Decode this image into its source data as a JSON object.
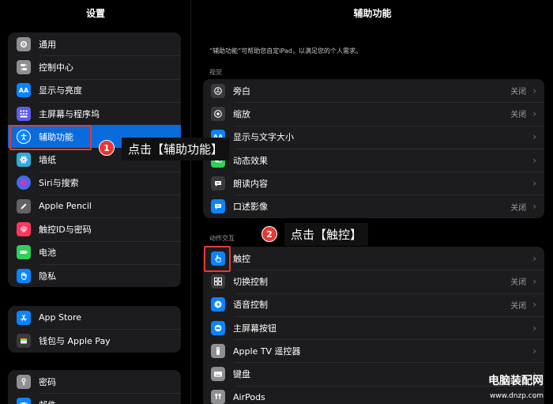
{
  "sidebar": {
    "title": "设置",
    "group1": [
      {
        "label": "通用",
        "icon": "gear-icon",
        "color": "#8e8e93"
      },
      {
        "label": "控制中心",
        "icon": "toggles-icon",
        "color": "#8e8e93"
      },
      {
        "label": "显示与亮度",
        "icon": "text-size-icon",
        "color": "#0a84ff"
      },
      {
        "label": "主屏幕与程序坞",
        "icon": "grid-icon",
        "color": "#5e5ce6"
      },
      {
        "label": "辅助功能",
        "icon": "accessibility-icon",
        "color": "#0a84ff"
      },
      {
        "label": "墙纸",
        "icon": "flower-icon",
        "color": "#34aadc"
      },
      {
        "label": "Siri与搜索",
        "icon": "siri-icon",
        "color": "#222222"
      },
      {
        "label": "Apple Pencil",
        "icon": "pencil-icon",
        "color": "#636366"
      },
      {
        "label": "触控ID与密码",
        "icon": "fingerprint-icon",
        "color": "#ff375f"
      },
      {
        "label": "电池",
        "icon": "battery-icon",
        "color": "#30d158"
      },
      {
        "label": "隐私",
        "icon": "hand-icon",
        "color": "#0a84ff"
      }
    ],
    "group2": [
      {
        "label": "App Store",
        "icon": "appstore-icon",
        "color": "#0a84ff"
      },
      {
        "label": "钱包与 Apple Pay",
        "icon": "wallet-icon",
        "color": "#3a3a3c"
      }
    ],
    "group3": [
      {
        "label": "密码",
        "icon": "key-icon",
        "color": "#8e8e93"
      },
      {
        "label": "邮件",
        "icon": "mail-icon",
        "color": "#0a84ff"
      }
    ]
  },
  "main": {
    "title": "辅助功能",
    "description": "“辅助功能”可帮助您自定iPad，以满足您的个人需求。",
    "section_vision": "视觉",
    "vision_rows": [
      {
        "label": "旁白",
        "value": "关闭",
        "icon": "voiceover-icon",
        "color": "#3a3a3c"
      },
      {
        "label": "缩放",
        "value": "关闭",
        "icon": "zoom-icon",
        "color": "#3a3a3c"
      },
      {
        "label": "显示与文字大小",
        "value": "",
        "icon": "text-size-icon",
        "color": "#0a84ff"
      },
      {
        "label": "动态效果",
        "value": "",
        "icon": "motion-icon",
        "color": "#30d158"
      },
      {
        "label": "朗读内容",
        "value": "",
        "icon": "speech-bubble-icon",
        "color": "#3a3a3c"
      },
      {
        "label": "口述影像",
        "value": "关闭",
        "icon": "audio-description-icon",
        "color": "#0a84ff"
      }
    ],
    "section_interaction": "动作交互",
    "interaction_rows": [
      {
        "label": "触控",
        "value": "",
        "icon": "touch-hand-icon",
        "color": "#0a84ff"
      },
      {
        "label": "切换控制",
        "value": "关闭",
        "icon": "switch-control-icon",
        "color": "#3a3a3c"
      },
      {
        "label": "语音控制",
        "value": "关闭",
        "icon": "voice-control-icon",
        "color": "#0a84ff"
      },
      {
        "label": "主屏幕按钮",
        "value": "",
        "icon": "home-button-icon",
        "color": "#0a84ff"
      },
      {
        "label": "Apple TV 遥控器",
        "value": "",
        "icon": "remote-icon",
        "color": "#8e8e93"
      },
      {
        "label": "键盘",
        "value": "",
        "icon": "keyboard-icon",
        "color": "#8e8e93"
      },
      {
        "label": "AirPods",
        "value": "",
        "icon": "airpods-icon",
        "color": "#8e8e93"
      }
    ]
  },
  "annotations": {
    "step1_number": "1",
    "step1_text": "点击【辅助功能】",
    "step2_number": "2",
    "step2_text": "点击【触控】",
    "accent": "#e53935"
  },
  "watermark": {
    "line1": "电脑装配网",
    "line2": "www.dnzp.com"
  }
}
